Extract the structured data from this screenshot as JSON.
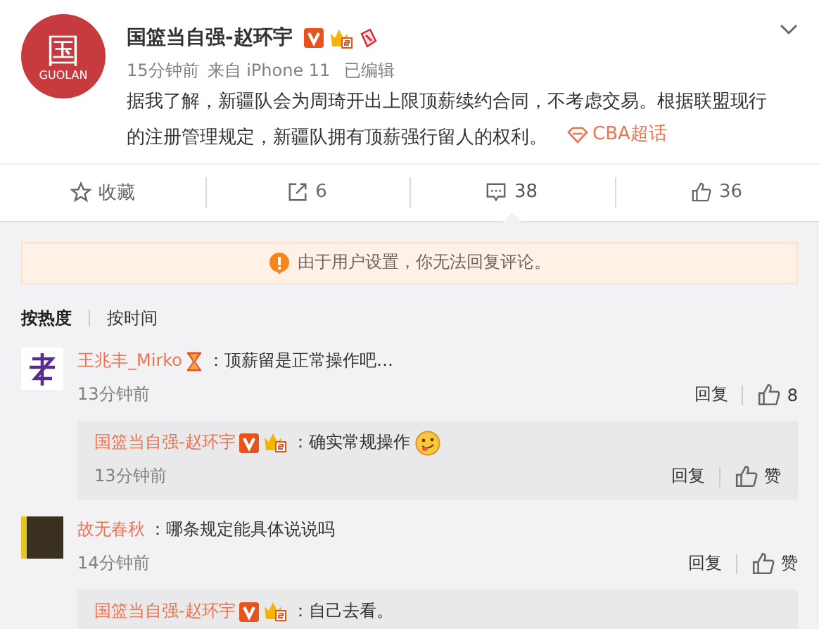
{
  "post": {
    "avatar": {
      "glyph": "国",
      "caption": "GUOLAN"
    },
    "author": "国篮当自强-赵环宇",
    "badges": [
      {
        "kind": "verified"
      },
      {
        "kind": "crown"
      },
      {
        "kind": "gift"
      }
    ],
    "time": "15分钟前",
    "source": "来自 iPhone 11",
    "edited": "已编辑",
    "text": "据我了解，新疆队会为周琦开出上限顶薪续约合同，不考虑交易。根据联盟现行的注册管理规定，新疆队拥有顶薪强行留人的权利。",
    "topic": "CBA超话"
  },
  "actions": [
    {
      "kind": "favorite",
      "label": "收藏",
      "selected": false
    },
    {
      "kind": "repost",
      "label": "6",
      "selected": false
    },
    {
      "kind": "comment",
      "label": "38",
      "selected": true
    },
    {
      "kind": "like",
      "label": "36",
      "selected": false
    }
  ],
  "notice": "由于用户设置，你无法回复评论。",
  "sort_tabs": [
    {
      "label": "按热度",
      "selected": true
    },
    {
      "label": "按时间",
      "selected": false
    }
  ],
  "comments": [
    {
      "kind": "logo",
      "author": "王兆丰_Mirko",
      "badges": [
        {
          "kind": "hourglass"
        }
      ],
      "text": "：顶薪留是正常操作吧…",
      "time": "13分钟前",
      "reply_label": "回复",
      "like_label": "8",
      "replies": [
        {
          "author": "国篮当自强-赵环宇",
          "badges": [
            {
              "kind": "verified"
            },
            {
              "kind": "crown"
            }
          ],
          "text": "：确实常规操作",
          "emoji": true,
          "time": "13分钟前",
          "reply_label": "回复",
          "like_label": "赞"
        }
      ]
    },
    {
      "kind": "photo",
      "author": "故无春秋",
      "text": "：哪条规定能具体说说吗",
      "time": "14分钟前",
      "reply_label": "回复",
      "like_label": "赞",
      "replies": [
        {
          "author": "国篮当自强-赵环宇",
          "badges": [
            {
              "kind": "verified"
            },
            {
              "kind": "crown"
            }
          ],
          "text": "：自己去看。",
          "emoji": false
        }
      ]
    }
  ]
}
